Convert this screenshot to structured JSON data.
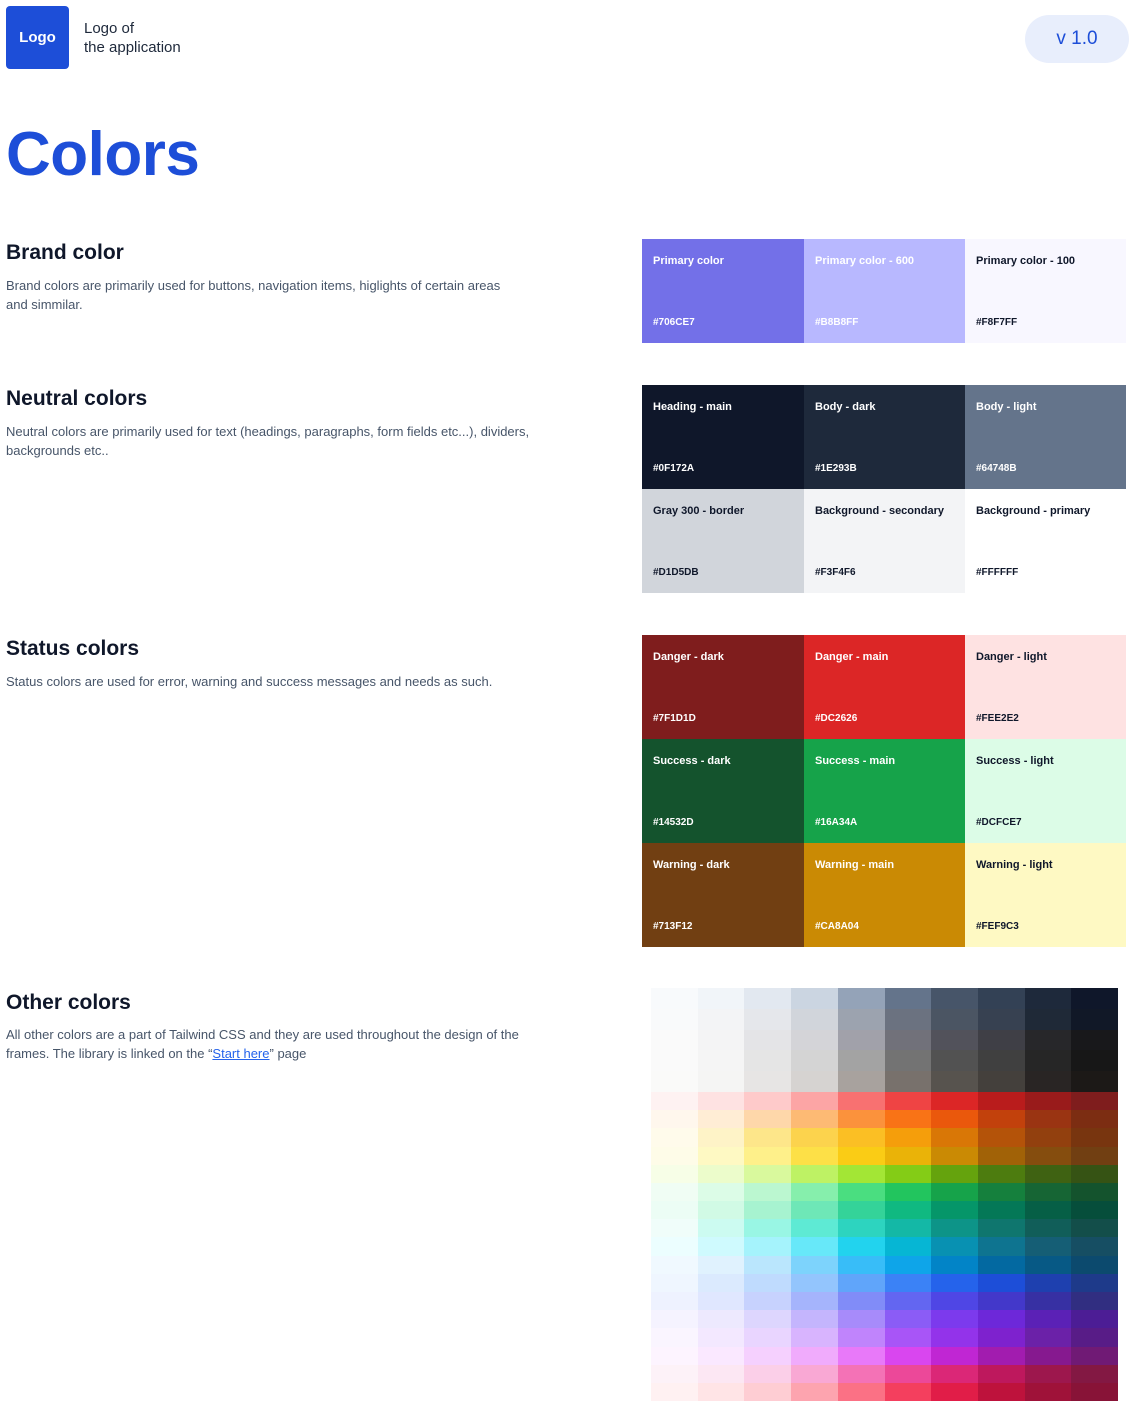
{
  "header": {
    "logo_label": "Logo",
    "logo_caption_line1": "Logo of",
    "logo_caption_line2": "the application",
    "version": "v 1.0"
  },
  "page_title": "Colors",
  "sections": {
    "brand": {
      "title": "Brand color",
      "description": "Brand colors are primarily used for buttons, navigation items, higlights of certain areas and simmilar.",
      "swatches": [
        {
          "label": "Primary color",
          "hex": "#706CE7",
          "bg": "#7370E8",
          "text_color": "#FFFFFF"
        },
        {
          "label": "Primary color - 600",
          "hex": "#B8B8FF",
          "bg": "#B8B8FF",
          "text_color": "#FFFFFF"
        },
        {
          "label": "Primary color - 100",
          "hex": "#F8F7FF",
          "bg": "#F8F7FF",
          "text_color": "#0F172A"
        }
      ]
    },
    "neutral": {
      "title": "Neutral colors",
      "description": "Neutral colors are primarily used for text (headings, paragraphs, form fields etc...), dividers, backgrounds etc..",
      "swatches": [
        {
          "label": "Heading - main",
          "hex": "#0F172A",
          "bg": "#0F172A",
          "text_color": "#FFFFFF"
        },
        {
          "label": "Body - dark",
          "hex": "#1E293B",
          "bg": "#1E293B",
          "text_color": "#FFFFFF"
        },
        {
          "label": "Body - light",
          "hex": "#64748B",
          "bg": "#64748B",
          "text_color": "#FFFFFF"
        },
        {
          "label": "Gray 300 - border",
          "hex": "#D1D5DB",
          "bg": "#D1D5DB",
          "text_color": "#0F172A"
        },
        {
          "label": "Background - secondary",
          "hex": "#F3F4F6",
          "bg": "#F3F4F6",
          "text_color": "#0F172A"
        },
        {
          "label": "Background - primary",
          "hex": "#FFFFFF",
          "bg": "#FFFFFF",
          "text_color": "#0F172A"
        }
      ]
    },
    "status": {
      "title": "Status colors",
      "description": "Status colors are used for error, warning and success messages and needs as such.",
      "swatches": [
        {
          "label": "Danger - dark",
          "hex": "#7F1D1D",
          "bg": "#7F1D1D",
          "text_color": "#FFFFFF"
        },
        {
          "label": "Danger - main",
          "hex": "#DC2626",
          "bg": "#DC2626",
          "text_color": "#FFFFFF"
        },
        {
          "label": "Danger - light",
          "hex": "#FEE2E2",
          "bg": "#FEE2E2",
          "text_color": "#0F172A"
        },
        {
          "label": "Success - dark",
          "hex": "#14532D",
          "bg": "#14532D",
          "text_color": "#FFFFFF"
        },
        {
          "label": "Success - main",
          "hex": "#16A34A",
          "bg": "#16A34A",
          "text_color": "#FFFFFF"
        },
        {
          "label": "Success - light",
          "hex": "#DCFCE7",
          "bg": "#DCFCE7",
          "text_color": "#0F172A"
        },
        {
          "label": "Warning - dark",
          "hex": "#713F12",
          "bg": "#713F12",
          "text_color": "#FFFFFF"
        },
        {
          "label": "Warning - main",
          "hex": "#CA8A04",
          "bg": "#CA8A04",
          "text_color": "#FFFFFF"
        },
        {
          "label": "Warning - light",
          "hex": "#FEF9C3",
          "bg": "#FEF9C3",
          "text_color": "#0F172A"
        }
      ]
    },
    "other": {
      "title": "Other colors",
      "description_before": "All other colors are a part of Tailwind CSS and they are used throughout the design of the frames. The library is linked on the “",
      "link_text": "Start here",
      "description_after": "” page"
    }
  },
  "palette": {
    "neutral_rows": [
      [
        "#F8FAFC",
        "#F1F5F9",
        "#E2E8F0",
        "#CBD5E1",
        "#94A3B8",
        "#64748B",
        "#475569",
        "#334155",
        "#1E293B",
        "#0F172A"
      ],
      [
        "#F9FAFB",
        "#F3F4F6",
        "#E5E7EB",
        "#D1D5DB",
        "#9CA3AF",
        "#6B7280",
        "#4B5563",
        "#374151",
        "#1F2937",
        "#111827"
      ],
      [
        "#FAFAFA",
        "#F4F4F5",
        "#E4E4E7",
        "#D4D4D8",
        "#A1A1AA",
        "#71717A",
        "#52525B",
        "#3F3F46",
        "#27272A",
        "#18181B"
      ],
      [
        "#FAFAFA",
        "#F5F5F5",
        "#E5E5E5",
        "#D4D4D4",
        "#A3A3A3",
        "#737373",
        "#525252",
        "#404040",
        "#262626",
        "#171717"
      ],
      [
        "#FAFAF9",
        "#F5F5F4",
        "#E7E5E4",
        "#D6D3D1",
        "#A8A29E",
        "#78716C",
        "#57534E",
        "#44403C",
        "#292524",
        "#1C1917"
      ]
    ],
    "color_rows": [
      [
        "#FEF2F2",
        "#FEE2E2",
        "#FECACA",
        "#FCA5A5",
        "#F87171",
        "#EF4444",
        "#DC2626",
        "#B91C1C",
        "#991B1B",
        "#7F1D1D"
      ],
      [
        "#FFF7ED",
        "#FFEDD5",
        "#FED7AA",
        "#FDBA74",
        "#FB923C",
        "#F97316",
        "#EA580C",
        "#C2410C",
        "#9A3412",
        "#7C2D12"
      ],
      [
        "#FFFBEB",
        "#FEF3C7",
        "#FDE68A",
        "#FCD34D",
        "#FBBF24",
        "#F59E0B",
        "#D97706",
        "#B45309",
        "#92400E",
        "#78350F"
      ],
      [
        "#FEFCE8",
        "#FEF9C3",
        "#FEF08A",
        "#FDE047",
        "#FACC15",
        "#EAB308",
        "#CA8A04",
        "#A16207",
        "#854D0E",
        "#713F12"
      ],
      [
        "#F7FEE7",
        "#ECFCCB",
        "#D9F99D",
        "#BEF264",
        "#A3E635",
        "#84CC16",
        "#65A30D",
        "#4D7C0F",
        "#3F6212",
        "#365314"
      ],
      [
        "#F0FDF4",
        "#DCFCE7",
        "#BBF7D0",
        "#86EFAC",
        "#4ADE80",
        "#22C55E",
        "#16A34A",
        "#15803D",
        "#166534",
        "#14532D"
      ],
      [
        "#ECFDF5",
        "#D1FAE5",
        "#A7F3D0",
        "#6EE7B7",
        "#34D399",
        "#10B981",
        "#059669",
        "#047857",
        "#065F46",
        "#064E3B"
      ],
      [
        "#F0FDFA",
        "#CCFBF1",
        "#99F6E4",
        "#5EEAD4",
        "#2DD4BF",
        "#14B8A6",
        "#0D9488",
        "#0F766E",
        "#115E59",
        "#134E4A"
      ],
      [
        "#ECFEFF",
        "#CFFAFE",
        "#A5F3FC",
        "#67E8F9",
        "#22D3EE",
        "#06B6D4",
        "#0891B2",
        "#0E7490",
        "#155E75",
        "#164E63"
      ],
      [
        "#F0F9FF",
        "#E0F2FE",
        "#BAE6FD",
        "#7DD3FC",
        "#38BDF8",
        "#0EA5E9",
        "#0284C7",
        "#0369A1",
        "#075985",
        "#0C4A6E"
      ],
      [
        "#EFF6FF",
        "#DBEAFE",
        "#BFDBFE",
        "#93C5FD",
        "#60A5FA",
        "#3B82F6",
        "#2563EB",
        "#1D4ED8",
        "#1E40AF",
        "#1E3A8A"
      ],
      [
        "#EEF2FF",
        "#E0E7FF",
        "#C7D2FE",
        "#A5B4FC",
        "#818CF8",
        "#6366F1",
        "#4F46E5",
        "#4338CA",
        "#3730A3",
        "#312E81"
      ],
      [
        "#F5F3FF",
        "#EDE9FE",
        "#DDD6FE",
        "#C4B5FD",
        "#A78BFA",
        "#8B5CF6",
        "#7C3AED",
        "#6D28D9",
        "#5B21B6",
        "#4C1D95"
      ],
      [
        "#FAF5FF",
        "#F3E8FF",
        "#E9D5FF",
        "#D8B4FE",
        "#C084FC",
        "#A855F7",
        "#9333EA",
        "#7E22CE",
        "#6B21A8",
        "#581C87"
      ],
      [
        "#FDF4FF",
        "#FAE8FF",
        "#F5D0FE",
        "#F0ABFC",
        "#E879F9",
        "#D946EF",
        "#C026D3",
        "#A21CAF",
        "#86198F",
        "#701A75"
      ],
      [
        "#FDF2F8",
        "#FCE7F3",
        "#FBCFE8",
        "#F9A8D4",
        "#F472B6",
        "#EC4899",
        "#DB2777",
        "#BE185D",
        "#9D174D",
        "#831843"
      ],
      [
        "#FFF1F2",
        "#FFE4E6",
        "#FECDD3",
        "#FDA4AF",
        "#FB7185",
        "#F43F5E",
        "#E11D48",
        "#BE123C",
        "#9F1239",
        "#881337"
      ]
    ]
  }
}
